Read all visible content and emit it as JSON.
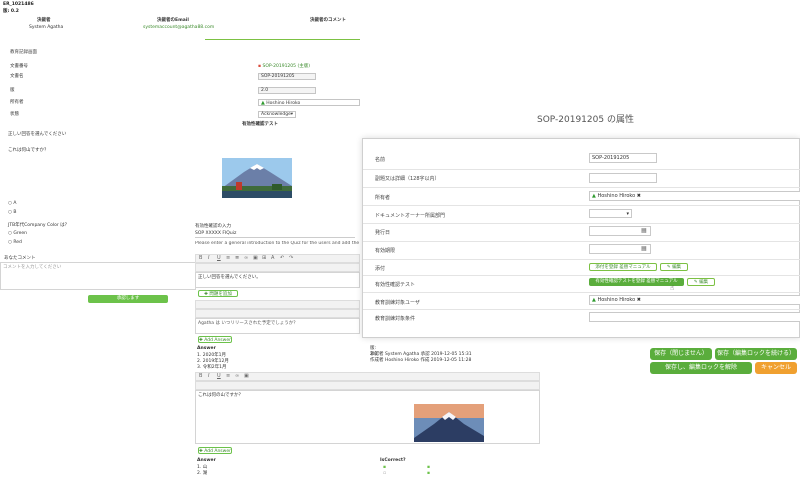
{
  "document": {
    "code": "ER_1021486",
    "version_line": "版: 0.2"
  },
  "header_table": {
    "col1_head": "決裁者",
    "col1_value": "System Agatha",
    "col2_head": "決裁者のEmail",
    "col2_value": "systemaccount@agatha88.com",
    "col3_head": "決裁者のコメント"
  },
  "form": {
    "section_title": "教育記録画面",
    "doc_number_label": "文書番号",
    "doc_number_link": "SOP-20191205 (主版)",
    "title_label": "文書名",
    "title_value": "SOP-20191205",
    "version_label": "版",
    "version_value": "2.0",
    "owner_label": "所有者",
    "owner_value": "Hoshino Hiroko",
    "status_label": "状態",
    "status_value": "Acknowledge",
    "quiz_title": "有効性確認テスト",
    "q1": "正しい回答を選んでください",
    "q2": "これは何山ですか？",
    "option_a": "A",
    "option_b": "B",
    "q3": "JTB年代Company Color は？",
    "option_green": "Green",
    "option_red": "Red",
    "comment_label": "あなたコメント",
    "comment_placeholder": "コメントを入力してください",
    "submit": "承認します"
  },
  "quiz_editor": {
    "intro_label": "有効性確認の入力",
    "intro_value": "SOP XXXXX FIQuiz",
    "instruction": "Please enter a general introduction to the Quiz for the users and add the list of questions and answers below.",
    "editor1_text": "正しい回答を選んでください。",
    "add_question": "問題を追加",
    "editor2_text": "Agatha は いつリリースされた予定でしょうか？",
    "add_answer": "Add Answer",
    "answer_heading": "Answer",
    "answers": [
      "2020年1月",
      "2019年12月",
      "令和2年1月"
    ],
    "editor3_text": "これは何の山ですか？",
    "answer_heading2": "Answer",
    "is_correct_heading": "IsCorrect?",
    "answers2": [
      "山",
      "湖"
    ]
  },
  "history": {
    "version_line": "版: 2.0",
    "row1_label": "承認者",
    "row1_value": "System Agatha 承認 2019-12-05 15:31",
    "row2_label": "作成者",
    "row2_value": "Hoshino Hiroko 作成 2019-12-05 11:28"
  },
  "modal": {
    "title": "SOP-20191205 の属性",
    "name_label": "名前",
    "name_value": "SOP-20191205",
    "subtitle_label": "副題又は詳細（128字以内）",
    "owner_label": "所有者",
    "owner_value": "Hoshino Hiroko",
    "dept_label": "ドキュメントオーナー所属部門",
    "issue_date_label": "発行日",
    "expiry_label": "有効期限",
    "attachment_label": "添付",
    "attachment_file": "添付を登録 差替マニュアル",
    "attachment_edit": "編集",
    "quiz_label": "有効性確認テスト",
    "quiz_file": "有効性確認テストを登録 差替マニュアル",
    "quiz_edit": "編集",
    "trainee_label": "教育訓練対象ユーザ",
    "trainee_value": "Hoshino Hiroko",
    "condition_label": "教育訓練対象条件"
  },
  "actions": {
    "save_no_change": "保存（閉じません）",
    "save_keep_lock": "保存（編集ロックを続ける）",
    "save_release_lock": "保存し、編集ロックを解除",
    "cancel": "キャンセル"
  },
  "colors": {
    "green": "#5aad3c",
    "green_light": "#7cc143",
    "orange": "#f0a030",
    "link_red": "#d94a3a"
  }
}
